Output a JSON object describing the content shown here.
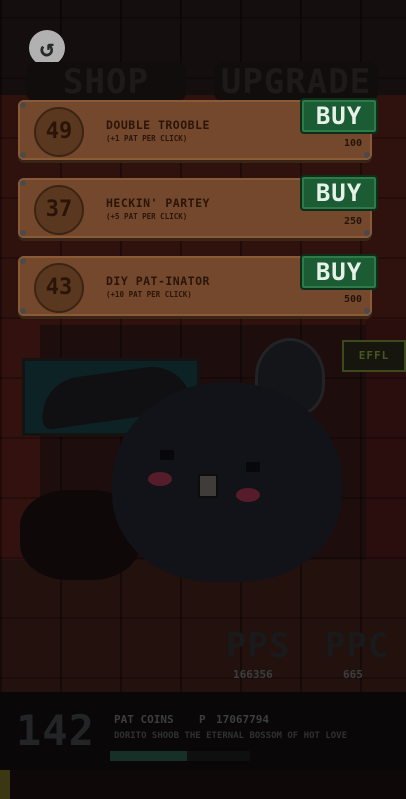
{
  "scene": {
    "tabs": {
      "shop": "SHOP",
      "upgrade": "UPGRADE"
    },
    "back_icon": "undo-arrow-icon",
    "sign": "EFFL"
  },
  "shop": {
    "items": [
      {
        "level": "49",
        "name": "DOUBLE TROOBLE",
        "desc": "(+1 PAT PER CLICK)",
        "price": "100",
        "buy": "BUY"
      },
      {
        "level": "37",
        "name": "HECKIN' PARTEY",
        "desc": "(+5 PAT PER CLICK)",
        "price": "250",
        "buy": "BUY"
      },
      {
        "level": "43",
        "name": "DIY PAT-INATOR",
        "desc": "(+10 PAT PER CLICK)",
        "price": "500",
        "buy": "BUY"
      }
    ]
  },
  "stats": {
    "pps_label": "PPS",
    "pps_value": "166356",
    "ppc_label": "PPC",
    "ppc_value": "665"
  },
  "footer": {
    "coins": "142",
    "coins_label": "PAT COINS",
    "p_label": "P",
    "p_value": "17067794",
    "bunny_name": "DORITO SHOOB THE ETERNAL BOSSOM OF HOT LOVE",
    "progress_fraction": 0.55
  },
  "colors": {
    "card": "#74482c",
    "buy_button": "#1c5c34",
    "text_dark": "#2b1409"
  }
}
